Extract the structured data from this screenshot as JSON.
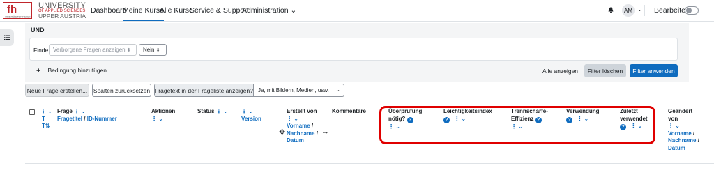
{
  "navbar": {
    "logo_mark": "fh",
    "logo_line1": "UNIVERSITY",
    "logo_line2": "OF APPLIED SCIENCES",
    "logo_line3": "UPPER AUSTRIA",
    "logo_sub": "OBERÖSTERREICH",
    "items": [
      "Dashboard",
      "Meine Kurse",
      "Alle Kurse",
      "Service & Support",
      "Administration ⌄"
    ],
    "avatar_initials": "AM",
    "edit_mode_label": "Bearbeiten"
  },
  "filter": {
    "join_label": "UND",
    "condition_label": "Finde",
    "condition_type": "Verborgene Fragen anzeigen",
    "condition_value": "Nein",
    "add_condition": "Bedingung hinzufügen",
    "show_all": "Alle anzeigen",
    "clear_button": "Filter löschen",
    "apply_button": "Filter anwenden"
  },
  "toolbar": {
    "new_question": "Neue Frage erstellen...",
    "reset_columns": "Spalten zurücksetzen",
    "show_text_label": "Fragetext in der Frageliste anzeigen?",
    "show_text_value": "Ja, mit Bildern, Medien, usw."
  },
  "columns": {
    "t": "T",
    "t_sort": "T⇅",
    "frage": "Frage",
    "fragetitel": "Fragetitel",
    "slash": "/",
    "id_nummer": "ID-Nummer",
    "aktionen": "Aktionen",
    "status": "Status",
    "version": "Version",
    "erstellt_von_1": "Erstellt von",
    "vorname": "Vorname",
    "nachname": "Nachname",
    "datum": "Datum",
    "kommentare": "Kommentare",
    "ueberpruefung_1": "Überprüfung",
    "ueberpruefung_2": "nötig?",
    "leichtigkeit": "Leichtigkeitsindex",
    "trenn_1": "Trennschärfe-",
    "trenn_2": "Effizienz",
    "verwendung": "Verwendung",
    "zuletzt_1": "Zuletzt",
    "zuletzt_2": "verwendet",
    "geaendert_1": "Geändert",
    "geaendert_2": "von"
  },
  "icons": {
    "menu": "list-icon",
    "bell": "bell-icon",
    "help": "?",
    "dots": "⋮ ⌄",
    "move": "✥",
    "resize": "↔"
  },
  "colors": {
    "primary": "#0f6cbf",
    "highlight": "#e00000",
    "panel": "#f4f5f6"
  }
}
